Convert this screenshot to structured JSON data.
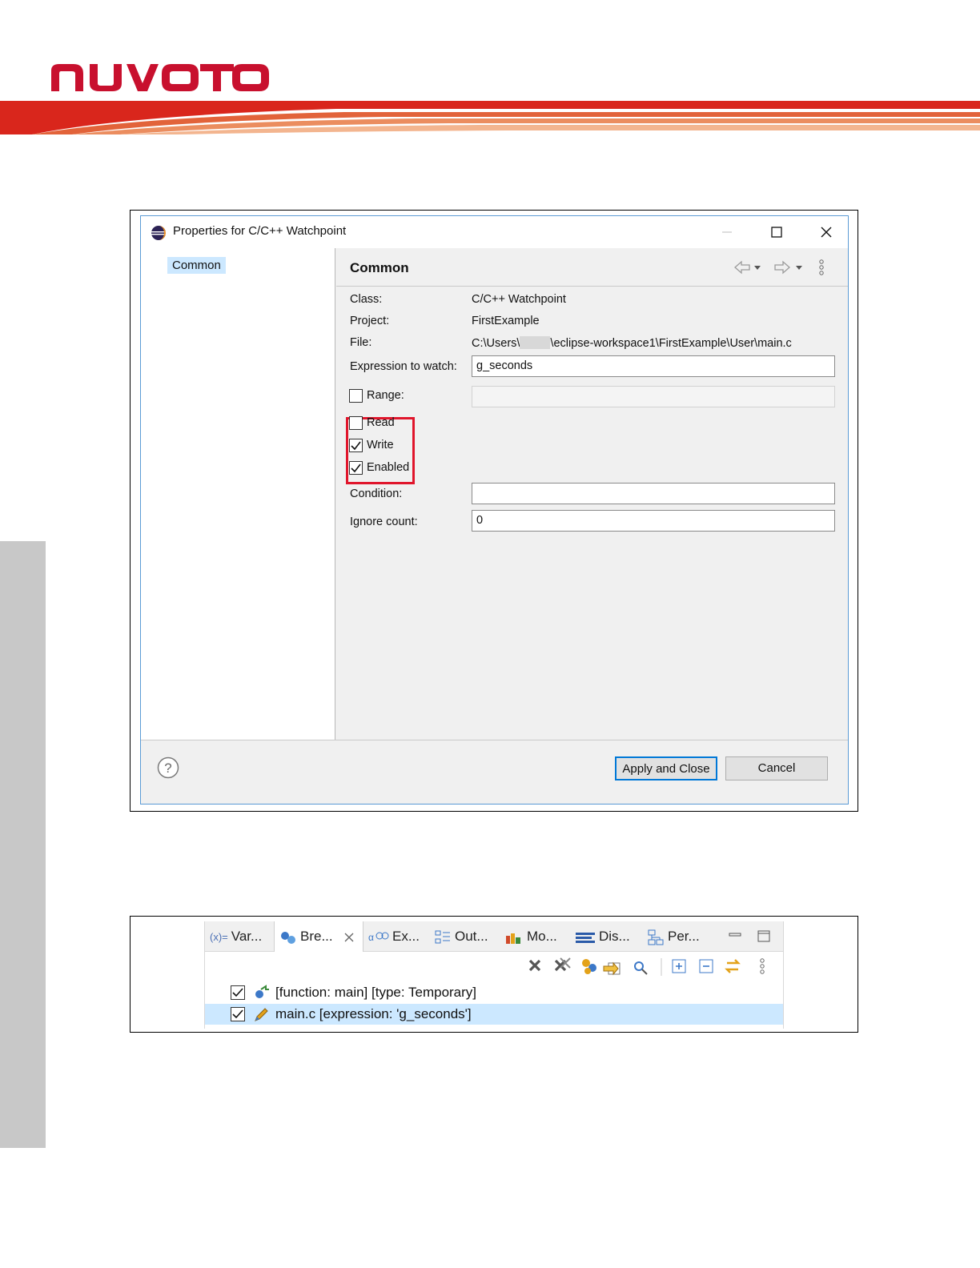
{
  "header": {
    "logo_text": "nuvoTon",
    "brand_color": "#c8102e"
  },
  "dialog": {
    "title": "Properties for C/C++ Watchpoint",
    "tree": {
      "selected_item": "Common"
    },
    "page_title": "Common",
    "fields": {
      "class_label": "Class:",
      "class_value": "C/C++ Watchpoint",
      "project_label": "Project:",
      "project_value": "FirstExample",
      "file_label": "File:",
      "file_value_prefix": "C:\\Users\\",
      "file_value_suffix": "\\eclipse-workspace1\\FirstExample\\User\\main.c",
      "expression_label": "Expression to watch:",
      "expression_value": "g_seconds",
      "range_label": "Range:",
      "range_value": "",
      "condition_label": "Condition:",
      "condition_value": "",
      "ignore_label": "Ignore count:",
      "ignore_value": "0"
    },
    "checkboxes": {
      "range": {
        "label": "Range:",
        "checked": false
      },
      "read": {
        "label": "Read",
        "checked": false
      },
      "write": {
        "label": "Write",
        "checked": true
      },
      "enabled": {
        "label": "Enabled",
        "checked": true
      }
    },
    "buttons": {
      "apply_close": "Apply and Close",
      "cancel": "Cancel"
    },
    "highlight_color": "#e0152b",
    "accent_color": "#0078d7"
  },
  "breakpoints_view": {
    "tabs": [
      {
        "label": "Var...",
        "icon": "variables-icon"
      },
      {
        "label": "Bre...",
        "icon": "breakpoints-icon",
        "active": true
      },
      {
        "label": "Ex...",
        "icon": "expressions-icon"
      },
      {
        "label": "Out...",
        "icon": "outline-icon"
      },
      {
        "label": "Mo...",
        "icon": "modules-icon"
      },
      {
        "label": "Dis...",
        "icon": "disassembly-icon"
      },
      {
        "label": "Per...",
        "icon": "peripherals-icon"
      }
    ],
    "tab_icon_variables_text": "(x)=",
    "rows": [
      {
        "text": "[function: main] [type: Temporary]",
        "checked": true,
        "icon": "function-breakpoint-icon"
      },
      {
        "text": "main.c [expression: 'g_seconds']",
        "checked": true,
        "icon": "watchpoint-icon",
        "selected": true
      }
    ]
  }
}
